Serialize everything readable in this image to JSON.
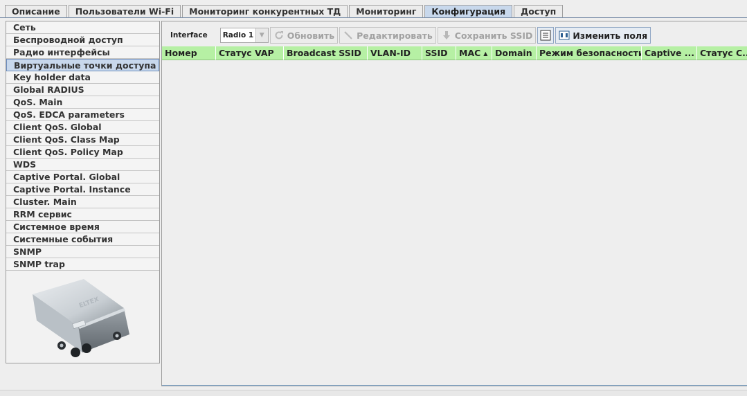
{
  "tabs": [
    {
      "label": "Описание",
      "active": false
    },
    {
      "label": "Пользователи Wi-Fi",
      "active": false
    },
    {
      "label": "Мониторинг конкурентных ТД",
      "active": false
    },
    {
      "label": "Мониторинг",
      "active": false
    },
    {
      "label": "Конфигурация",
      "active": true
    },
    {
      "label": "Доступ",
      "active": false
    }
  ],
  "sidebar": {
    "items": [
      "Сеть",
      "Беспроводной доступ",
      "Радио интерфейсы",
      "Виртуальные точки доступа",
      "Key holder data",
      "Global RADIUS",
      "QoS. Main",
      "QoS. EDCA parameters",
      "Client QoS. Global",
      "Client QoS. Class Map",
      "Client QoS. Policy Map",
      "WDS",
      "Captive Portal. Global",
      "Captive Portal. Instance",
      "Cluster. Main",
      "RRM сервис",
      "Системное время",
      "Системные события",
      "SNMP",
      "SNMP trap"
    ],
    "selected_index": 3,
    "device_logo": "ELTEX"
  },
  "toolbar": {
    "interface_label": "Interface",
    "interface_value": "Radio 1",
    "refresh_label": "Обновить",
    "edit_label": "Редактировать",
    "save_ssid_label": "Сохранить SSID",
    "change_fields_label": "Изменить поля",
    "icons": {
      "refresh": "refresh-icon",
      "edit": "pencil-icon",
      "save": "download-arrow-icon",
      "list": "list-icon",
      "fields": "columns-icon"
    }
  },
  "table": {
    "columns": [
      "Номер",
      "Статус VAP",
      "Broadcast SSID",
      "VLAN-ID",
      "SSID",
      "MAC",
      "Domain",
      "Режим безопасности",
      "Captive ...",
      "Статус С..."
    ],
    "sorted_column": "MAC",
    "sort_direction": "ascending",
    "rows": []
  },
  "colors": {
    "header_green": "#b6f0a4",
    "selection_blue": "#c8d8ec"
  }
}
